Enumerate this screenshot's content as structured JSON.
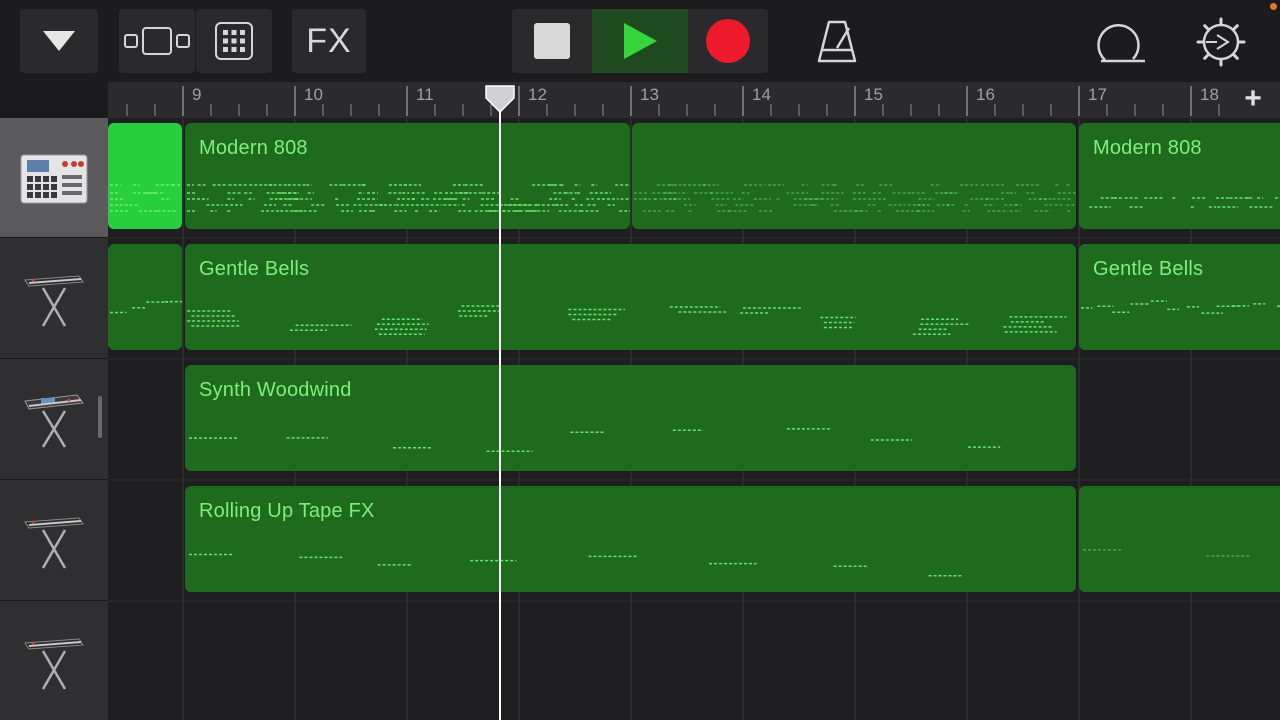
{
  "toolbar": {
    "fx_label": "FX",
    "icons": [
      "dropdown-triangle-icon",
      "view-switch-icon",
      "grid-icon",
      "stop-icon",
      "play-icon",
      "record-icon",
      "metronome-icon",
      "loop-icon",
      "settings-icon"
    ],
    "colors": {
      "play": "#35d63b",
      "record": "#ee1a2b",
      "play_bg": "#1f4a1f"
    }
  },
  "ruler": {
    "bars": [
      "9",
      "10",
      "11",
      "12",
      "13",
      "14",
      "15",
      "16",
      "17",
      "18"
    ],
    "add_label": "+"
  },
  "tracks": [
    {
      "instrument": "drum-machine-icon",
      "selected": true
    },
    {
      "instrument": "keyboard-icon",
      "selected": false
    },
    {
      "instrument": "synth-keyboard-icon",
      "selected": false
    },
    {
      "instrument": "keyboard-icon",
      "selected": false
    },
    {
      "instrument": "keyboard-icon",
      "selected": false
    }
  ],
  "regions": {
    "modern_808_a": "Modern 808",
    "modern_808_b": "Modern 808",
    "gentle_bells_a": "Gentle Bells",
    "gentle_bells_b": "Gentle Bells",
    "synth_woodwind": "Synth Woodwind",
    "rolling_up_tape_fx": "Rolling Up Tape FX"
  },
  "colors": {
    "region": "#1e6b1e",
    "region_active": "#27cf3c",
    "note": "#6ff07a",
    "region_title": "#7df07c"
  }
}
